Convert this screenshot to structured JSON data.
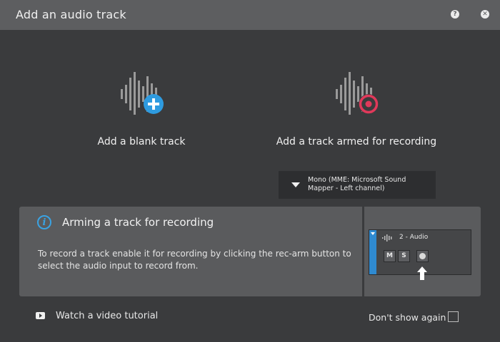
{
  "window": {
    "title": "Add an audio track",
    "help_icon": "help-icon",
    "close_icon": "close-icon"
  },
  "options": {
    "blank": {
      "label": "Add a blank track",
      "icon": "add-waveform-icon",
      "accent": "#2e9be0"
    },
    "armed": {
      "label": "Add a track armed for recording",
      "icon": "record-waveform-icon",
      "accent": "#e0395a"
    }
  },
  "input_select": {
    "value": "Mono (MME: Microsoft Sound Mapper - Left channel)"
  },
  "info": {
    "icon": "info-icon",
    "title": "Arming a track for recording",
    "body": "To record a track enable it for recording by clicking the rec-arm button to select the audio input to record from.",
    "track": {
      "name": "2 - Audio",
      "mute_label": "M",
      "solo_label": "S"
    }
  },
  "footer": {
    "video_label": "Watch a video tutorial",
    "dont_show_label": "Don't show again",
    "dont_show_checked": false
  },
  "colors": {
    "background": "#3a3b3d",
    "titlebar": "#5d5e60",
    "panel": "#5a5b5d",
    "info_accent": "#3aa3e3",
    "track_stripe": "#2f8ad0"
  }
}
